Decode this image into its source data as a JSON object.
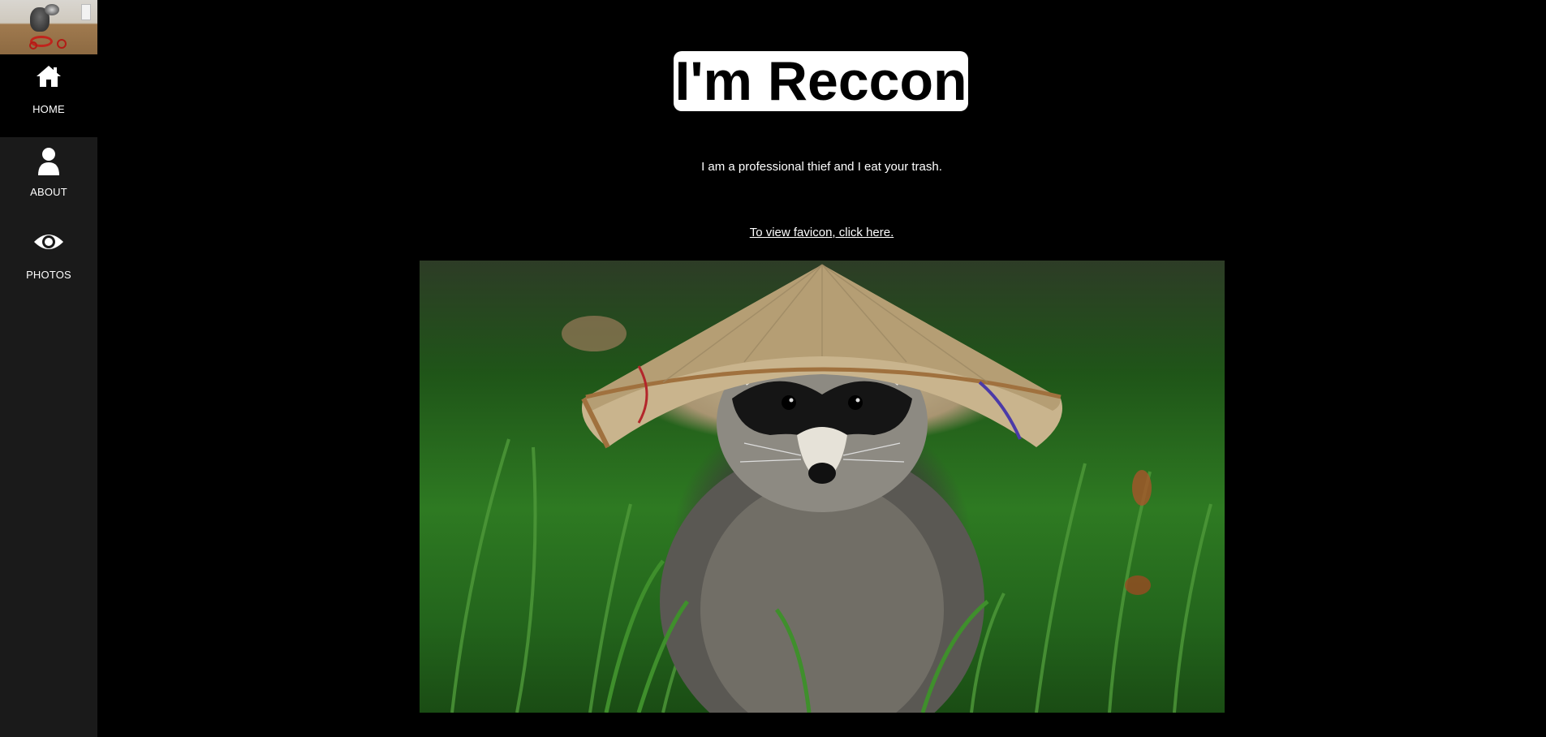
{
  "sidebar": {
    "logo_icon": "raccoon-on-tricycle-icon",
    "items": [
      {
        "label": "HOME",
        "icon": "home-icon",
        "active": true
      },
      {
        "label": "ABOUT",
        "icon": "user-icon",
        "active": false
      },
      {
        "label": "PHOTOS",
        "icon": "eye-icon",
        "active": false
      }
    ]
  },
  "main": {
    "title": "I'm Reccon",
    "subtitle": "I am a professional thief and I eat your trash.",
    "favicon_link": "To view favicon, click here.",
    "photo_subject": "raccoon-in-conical-hat"
  },
  "colors": {
    "background": "#000000",
    "sidebar": "#1a1a1a",
    "title_bg": "#ffffff",
    "text": "#ffffff"
  }
}
